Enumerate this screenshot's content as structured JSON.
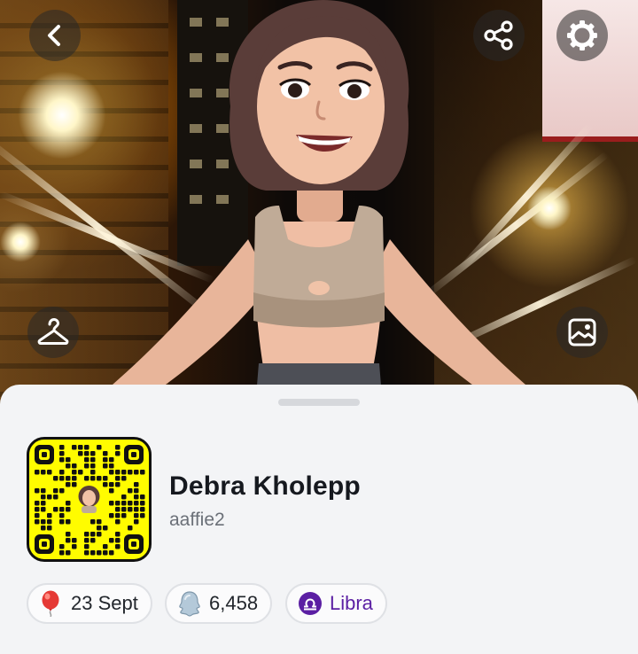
{
  "profile": {
    "display_name": "Debra Kholepp",
    "username": "aaffie2"
  },
  "header": {
    "back_icon": "chevron-left-icon",
    "share_icon": "share-icon",
    "settings_icon": "gear-icon",
    "outfit_icon": "hanger-icon",
    "background_icon": "image-icon"
  },
  "pills": {
    "birthday": {
      "icon": "balloon-icon",
      "label": "23 Sept"
    },
    "score": {
      "icon": "ghost-icon",
      "label": "6,458"
    },
    "zodiac": {
      "icon": "libra-icon",
      "label": "Libra"
    }
  },
  "colors": {
    "snapcode_yellow": "#fffc00",
    "zodiac_purple": "#5b1fa3",
    "balloon_red": "#e53935",
    "sheet_bg": "#f3f4f6"
  }
}
